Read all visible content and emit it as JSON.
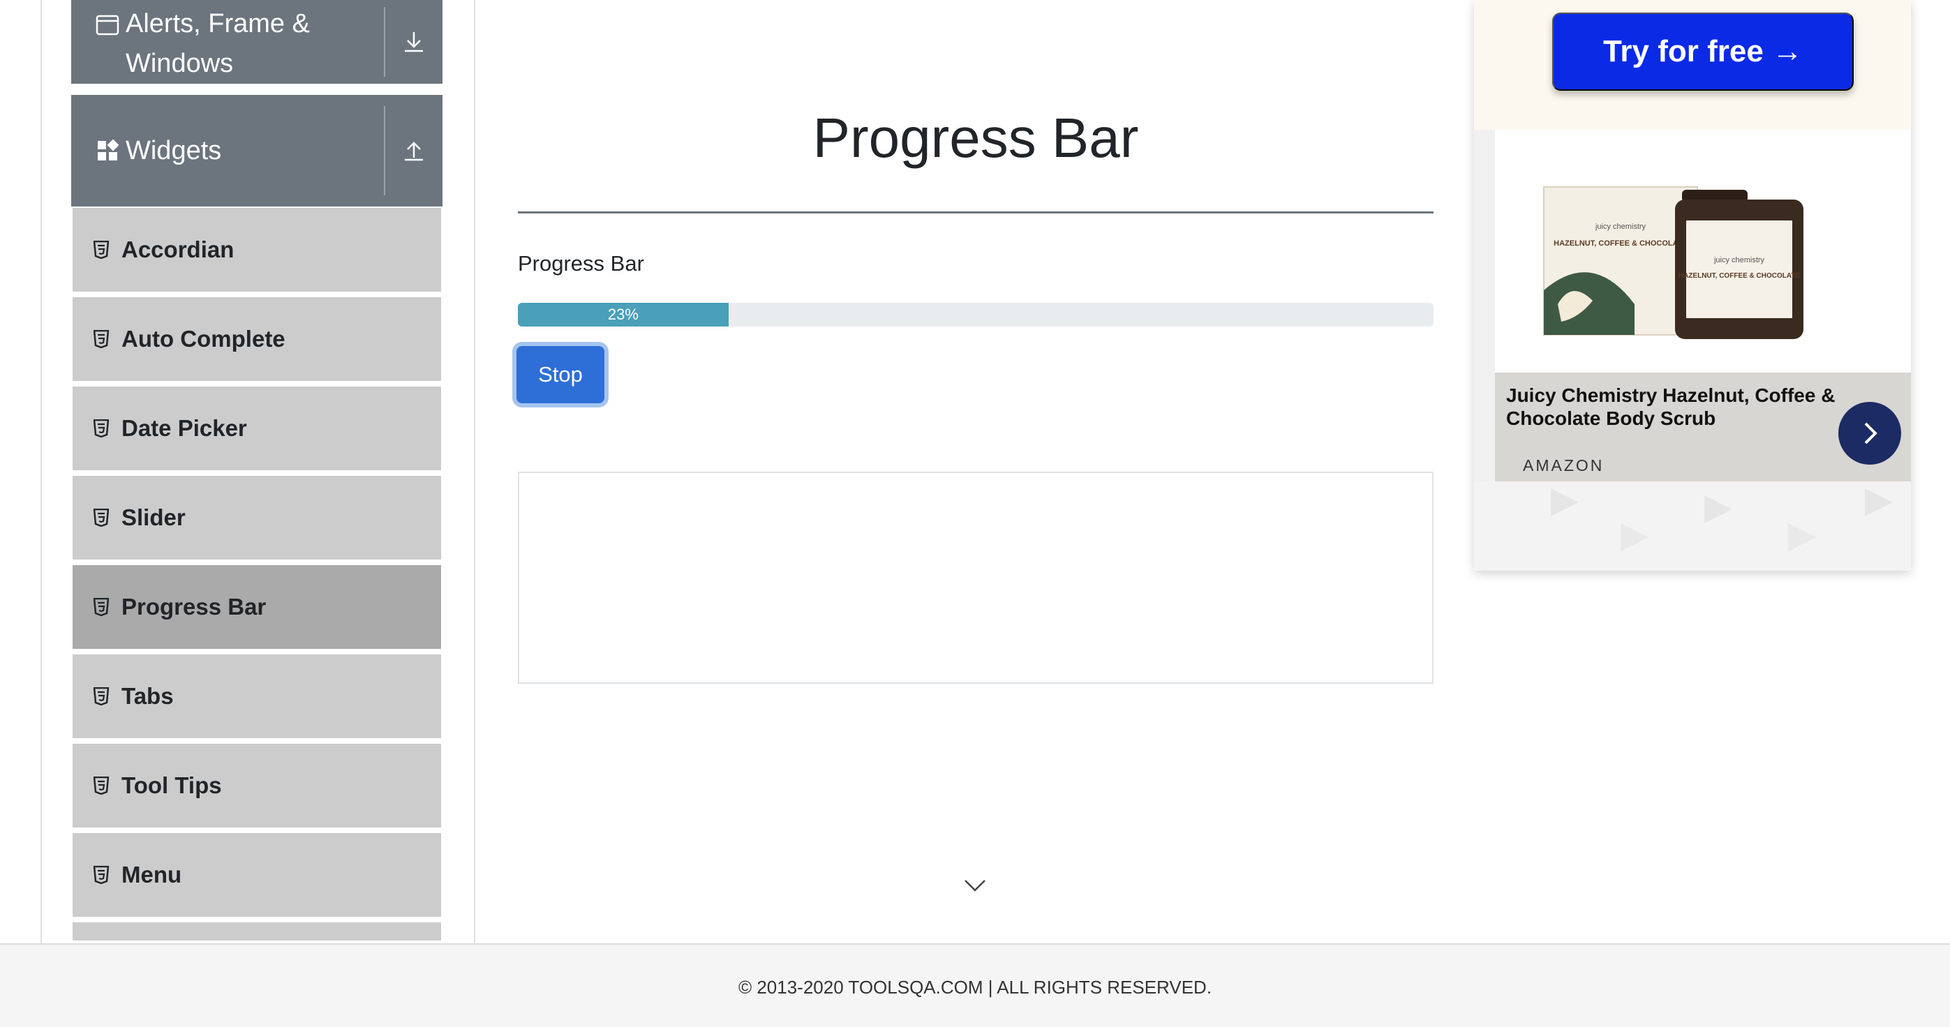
{
  "sidebar": {
    "groups": [
      {
        "label": "Alerts, Frame &\nWindows",
        "line1": "Alerts, Frame &",
        "line2": "Windows",
        "icon": "window-icon",
        "toggle_icon": "download-arrow-icon"
      },
      {
        "label": "Widgets",
        "icon": "grid-icon",
        "toggle_icon": "upload-arrow-icon"
      }
    ],
    "items": [
      {
        "label": "Accordian",
        "icon": "html5-icon"
      },
      {
        "label": "Auto Complete",
        "icon": "html5-icon"
      },
      {
        "label": "Date Picker",
        "icon": "html5-icon"
      },
      {
        "label": "Slider",
        "icon": "html5-icon"
      },
      {
        "label": "Progress Bar",
        "icon": "html5-icon",
        "active": true
      },
      {
        "label": "Tabs",
        "icon": "html5-icon"
      },
      {
        "label": "Tool Tips",
        "icon": "html5-icon"
      },
      {
        "label": "Menu",
        "icon": "html5-icon"
      }
    ]
  },
  "main": {
    "title": "Progress Bar",
    "section_label": "Progress Bar",
    "progress": {
      "value": 23,
      "label": "23%",
      "color": "#4a9fb9"
    },
    "stop_button_label": "Stop"
  },
  "ad": {
    "cta_label": "Try for free →",
    "product_title": "Juicy Chemistry Hazelnut, Coffee & Chocolate Body Scrub",
    "source": "AMAZON",
    "product_labels": {
      "brand": "juicy chemistry",
      "name": "HAZELNUT, COFFEE & CHOCOLATE"
    },
    "colors": {
      "cta": "#0a2ae6",
      "arrow": "#1c2b63"
    }
  },
  "footer": {
    "text": "© 2013-2020 TOOLSQA.COM | ALL RIGHTS RESERVED."
  }
}
